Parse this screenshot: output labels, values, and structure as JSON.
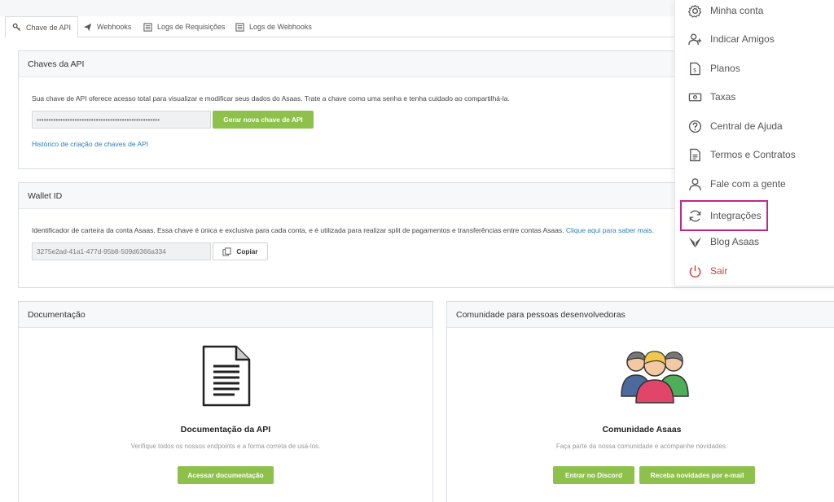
{
  "tabs": [
    {
      "label": "Chave de API",
      "icon": "key-icon"
    },
    {
      "label": "Webhooks",
      "icon": "paper-plane-icon"
    },
    {
      "label": "Logs de Requisições",
      "icon": "log-icon"
    },
    {
      "label": "Logs de Webhooks",
      "icon": "log-icon"
    }
  ],
  "api_keys": {
    "title": "Chaves da API",
    "description": "Sua chave de API oferece acesso total para visualizar e modificar seus dados do Asaas. Trate a chave como uma senha e tenha cuidado ao compartilhá-la.",
    "masked_key": "••••••••••••••••••••••••••••••••••••••••••••••••••••",
    "generate_label": "Gerar nova chave de API",
    "history_link": "Histórico de criação de chaves de API"
  },
  "wallet": {
    "title": "Wallet ID",
    "description": "Identificador de carteira da conta Asaas. Essa chave é única e exclusiva para cada conta, e é utilizada para realizar split de pagamentos e transferências entre contas Asaas.",
    "learn_more": "Clique aqui para saber mais.",
    "wallet_id": "3275e2ad-41a1-477d-95b8-509d6366a334",
    "copy_label": "Copiar"
  },
  "docs": {
    "title": "Documentação",
    "card_title": "Documentação da API",
    "card_sub": "Verifique todos os nossos endpoints e a forma correta de usá-los.",
    "button": "Acessar documentação"
  },
  "community": {
    "title": "Comunidade para pessoas desenvolvedoras",
    "card_title": "Comunidade Asaas",
    "card_sub": "Faça parte da nossa comunidade e acompanhe novidades.",
    "discord_button": "Entrar no Discord",
    "email_button": "Receba novidades por e-mail"
  },
  "menu": [
    {
      "label": "Minha conta",
      "icon": "gear-icon"
    },
    {
      "label": "Indicar Amigos",
      "icon": "add-user-icon"
    },
    {
      "label": "Planos",
      "icon": "plan-document-icon"
    },
    {
      "label": "Taxas",
      "icon": "money-icon"
    },
    {
      "label": "Central de Ajuda",
      "icon": "help-icon"
    },
    {
      "label": "Termos e Contratos",
      "icon": "document-icon"
    },
    {
      "label": "Fale com a gente",
      "icon": "user-icon"
    },
    {
      "label": "Integrações",
      "icon": "sync-icon"
    },
    {
      "label": "Blog Asaas",
      "icon": "blog-icon"
    },
    {
      "label": "Sair",
      "icon": "power-icon"
    }
  ],
  "colors": {
    "accent_green": "#8dc14b",
    "link_blue": "#2c7fb8",
    "highlight": "#c3268e",
    "danger": "#d13b3b"
  }
}
